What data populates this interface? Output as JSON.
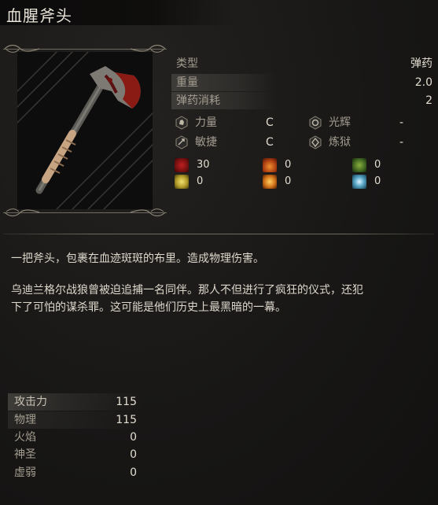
{
  "item": {
    "name": "血腥斧头"
  },
  "info": {
    "type_label": "类型",
    "type_value": "弹药",
    "weight_label": "重量",
    "weight_value": "2.0",
    "ammo_cost_label": "弹药消耗",
    "ammo_cost_value": "2"
  },
  "scaling": [
    {
      "label": "力量",
      "grade": "C",
      "icon": "strength-icon"
    },
    {
      "label": "光辉",
      "grade": "-",
      "icon": "radiance-icon"
    },
    {
      "label": "敏捷",
      "grade": "C",
      "icon": "dexterity-icon"
    },
    {
      "label": "炼狱",
      "grade": "-",
      "icon": "purgatory-icon"
    }
  ],
  "effects": [
    {
      "value": "30",
      "icon": "bleed-icon",
      "color": "#8a1414"
    },
    {
      "value": "0",
      "icon": "fire-status-icon",
      "color": "#b8501a"
    },
    {
      "value": "0",
      "icon": "poison-icon",
      "color": "#4f7a2a"
    },
    {
      "value": "0",
      "icon": "holy-status-icon",
      "color": "#c9b23a"
    },
    {
      "value": "0",
      "icon": "explosion-icon",
      "color": "#c9781c"
    },
    {
      "value": "0",
      "icon": "frost-icon",
      "color": "#4a8aa0"
    }
  ],
  "description": {
    "line1": "一把斧头，包裹在血迹斑斑的布里。造成物理伤害。",
    "line2": "乌迪兰格尔战狼曾被迫追捕一名同伴。那人不但进行了疯狂的仪式，还犯",
    "line3": "下了可怕的谋杀罪。这可能是他们历史上最黑暗的一幕。"
  },
  "attack": {
    "header_label": "攻击力",
    "header_value": "115",
    "rows": [
      {
        "label": "物理",
        "value": "115"
      },
      {
        "label": "火焰",
        "value": "0"
      },
      {
        "label": "神圣",
        "value": "0"
      },
      {
        "label": "虚弱",
        "value": "0"
      }
    ]
  }
}
